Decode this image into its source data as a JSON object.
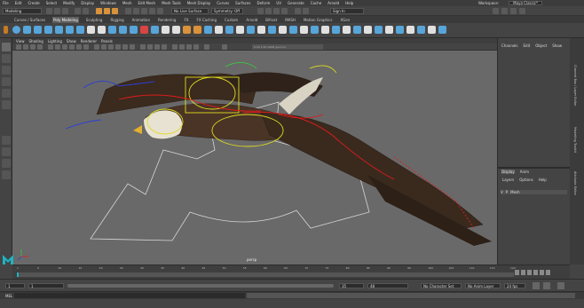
{
  "menubar": {
    "items": [
      "File",
      "Edit",
      "Create",
      "Select",
      "Modify",
      "Display",
      "Windows",
      "Mesh",
      "Edit Mesh",
      "Mesh Tools",
      "Mesh Display",
      "Curves",
      "Surfaces",
      "Deform",
      "UV",
      "Generate",
      "Cache",
      "Arnold",
      "Help"
    ],
    "workspace_label": "Workspace:",
    "workspace_value": "Maya Classic*"
  },
  "statusline": {
    "mode": "Modeling",
    "live_surface": "No Live Surface",
    "symmetry": "Symmetry: Off",
    "sign_in": "Sign In"
  },
  "shelf_tabs": [
    "Curves / Surfaces",
    "Poly Modeling",
    "Sculpting",
    "Rigging",
    "Animation",
    "Rendering",
    "FX",
    "FX Caching",
    "Custom",
    "Arnold",
    "Bifrost",
    "MASH",
    "Motion Graphics",
    "XGen"
  ],
  "shelf_active_index": 1,
  "viewport": {
    "menu": [
      "View",
      "Shading",
      "Lighting",
      "Show",
      "Renderer",
      "Panels"
    ],
    "camera_label": "persp",
    "camera_field": "0.00 1.00 sRGB gamma"
  },
  "channelbox": {
    "tabs": [
      "Channels",
      "Edit",
      "Object",
      "Show"
    ]
  },
  "layers": {
    "tabs": [
      "Display",
      "Anim"
    ],
    "active_tab": 0,
    "sub": [
      "Layers",
      "Options",
      "Help"
    ],
    "rows": [
      {
        "v": "V",
        "p": "P",
        "name": "Mesh"
      }
    ]
  },
  "sidebar_tabs": [
    "Channel Box / Layer Editor",
    "Modelling Toolkit",
    "Attribute Editor"
  ],
  "timeslider": {
    "ticks": [
      "1",
      "5",
      "10",
      "15",
      "20",
      "25",
      "30",
      "35",
      "40",
      "45",
      "50",
      "55",
      "60",
      "65",
      "70",
      "75",
      "80",
      "85",
      "90",
      "95",
      "100",
      "105",
      "110",
      "115",
      "120"
    ],
    "current_frame": "1"
  },
  "range": {
    "start": "1",
    "inner_start": "1",
    "inner_end": "120",
    "end_a": "35",
    "end_b": "48",
    "character_set": "No Character Set",
    "anim_layer": "No Anim Layer",
    "fps": "24 fps"
  },
  "cmdline": {
    "label": "MEL"
  },
  "colors": {
    "accent": "#1fb3c2",
    "rig_red": "#e21b1b",
    "rig_yellow": "#dcdc1e",
    "rig_blue": "#2b3fd6",
    "rig_green": "#3ec73e"
  }
}
